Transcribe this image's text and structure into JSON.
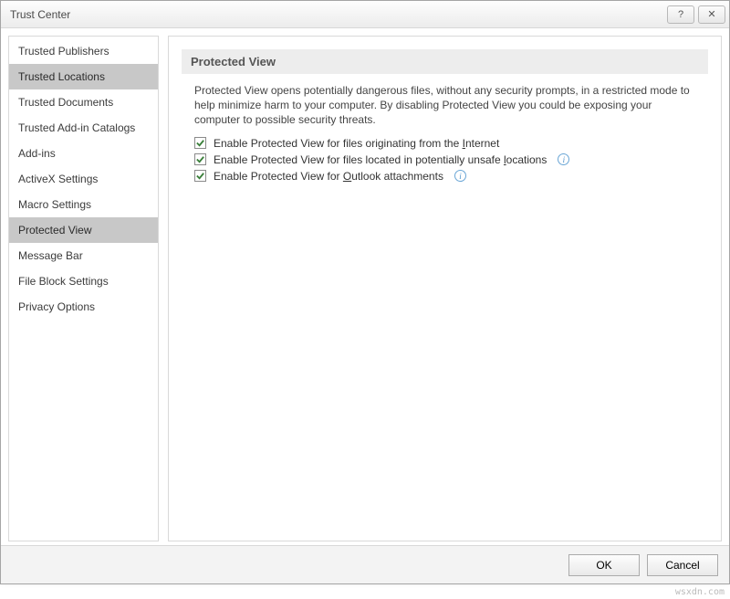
{
  "window": {
    "title": "Trust Center",
    "help_symbol": "?",
    "close_symbol": "✕"
  },
  "sidebar": {
    "items": [
      {
        "label": "Trusted Publishers",
        "selected": false
      },
      {
        "label": "Trusted Locations",
        "selected": true
      },
      {
        "label": "Trusted Documents",
        "selected": false
      },
      {
        "label": "Trusted Add-in Catalogs",
        "selected": false
      },
      {
        "label": "Add-ins",
        "selected": false
      },
      {
        "label": "ActiveX Settings",
        "selected": false
      },
      {
        "label": "Macro Settings",
        "selected": false
      },
      {
        "label": "Protected View",
        "selected": true
      },
      {
        "label": "Message Bar",
        "selected": false
      },
      {
        "label": "File Block Settings",
        "selected": false
      },
      {
        "label": "Privacy Options",
        "selected": false
      }
    ]
  },
  "main": {
    "section_title": "Protected View",
    "description": "Protected View opens potentially dangerous files, without any security prompts, in a restricted mode to help minimize harm to your computer. By disabling Protected View you could be exposing your computer to possible security threats.",
    "checkboxes": [
      {
        "label_pre": "Enable Protected View for files originating from the ",
        "mnemonic": "I",
        "label_post": "nternet",
        "checked": true,
        "info": false
      },
      {
        "label_pre": "Enable Protected View for files located in potentially unsafe ",
        "mnemonic": "l",
        "label_post": "ocations",
        "checked": true,
        "info": true
      },
      {
        "label_pre": "Enable Protected View for ",
        "mnemonic": "O",
        "label_post": "utlook attachments",
        "checked": true,
        "info": true
      }
    ]
  },
  "footer": {
    "ok": "OK",
    "cancel": "Cancel"
  },
  "watermark": "wsxdn.com"
}
